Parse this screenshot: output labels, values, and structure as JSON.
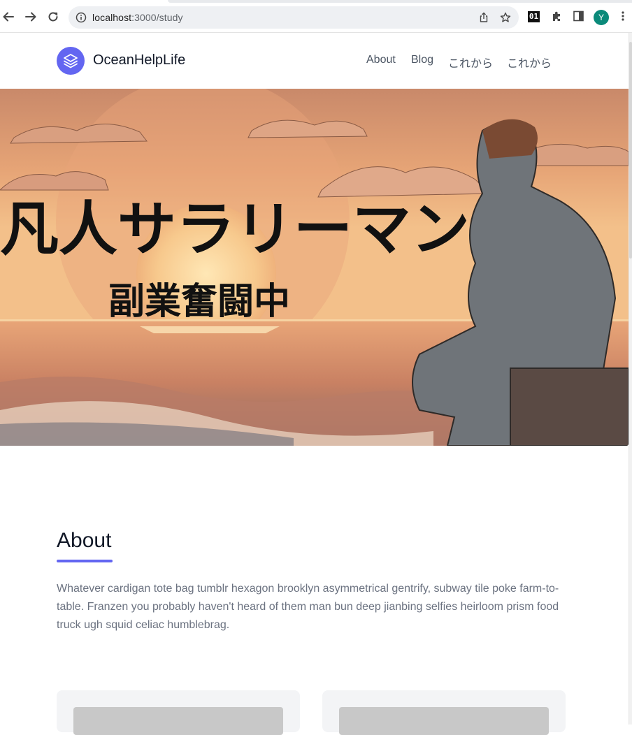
{
  "browser": {
    "url_host": "localhost",
    "url_path": ":3000/study",
    "extension_badge": "01",
    "profile_initial": "Y"
  },
  "site": {
    "brand": "OceanHelpLife",
    "nav": [
      "About",
      "Blog",
      "これから",
      "これから"
    ]
  },
  "hero": {
    "headline": "凡人サラリーマン",
    "subheadline": "副業奮闘中"
  },
  "about": {
    "title": "About",
    "text": "Whatever cardigan tote bag tumblr hexagon brooklyn asymmetrical gentrify, subway tile poke farm-to-table. Franzen you probably haven't heard of them man bun deep jianbing selfies heirloom prism food truck ugh squid celiac humblebrag."
  },
  "colors": {
    "accent": "#6366f1",
    "avatar": "#0b8a7a"
  }
}
